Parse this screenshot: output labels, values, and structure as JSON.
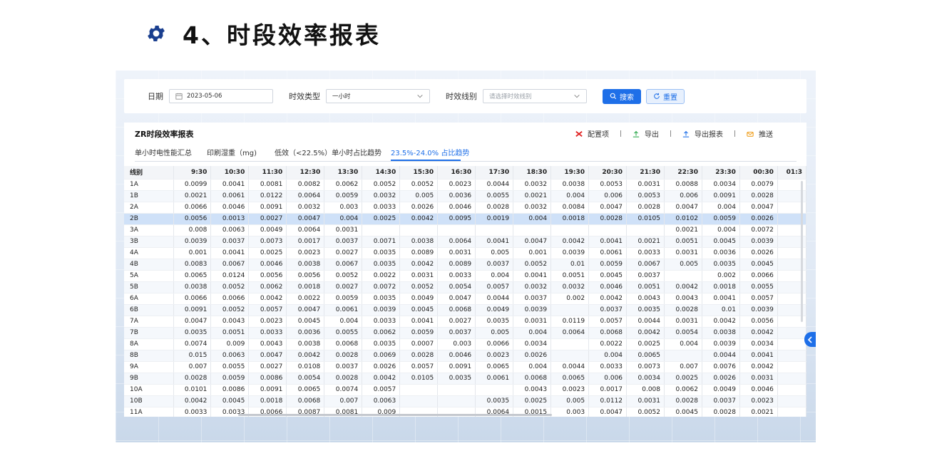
{
  "heading": {
    "icon": "gear-icon",
    "title": "4、时段效率报表"
  },
  "filter": {
    "date_label": "日期",
    "date_value": "2023-05-06",
    "type_label": "时效类型",
    "type_value": "一小时",
    "line_label": "时效线别",
    "line_placeholder": "请选择时效线别",
    "search_label": "搜索",
    "reset_label": "重置"
  },
  "report": {
    "title": "ZR时段效率报表",
    "actions": {
      "config": "配置项",
      "export": "导出",
      "export_report": "导出报表",
      "push": "推送"
    },
    "tabs": [
      "单小时电性能汇总",
      "印刷湿重（mg)",
      "低效（<22.5%）单小时占比趋势",
      "23.5%-24.0% 占比趋势"
    ],
    "active_tab": 3
  },
  "colors": {
    "accent": "#1e6fe8",
    "selected_row": "#cfe1f8",
    "config_icon": "#e02020",
    "export_icon": "#2aa84a",
    "push_icon": "#f0a020"
  },
  "table": {
    "columns": [
      "线别",
      "9:30",
      "10:30",
      "11:30",
      "12:30",
      "13:30",
      "14:30",
      "15:30",
      "16:30",
      "17:30",
      "18:30",
      "19:30",
      "20:30",
      "21:30",
      "22:30",
      "23:30",
      "00:30",
      "01:3"
    ],
    "selected_row": 3,
    "rows": [
      [
        "1A",
        "0.0099",
        "0.0041",
        "0.0081",
        "0.0082",
        "0.0062",
        "0.0052",
        "0.0052",
        "0.0023",
        "0.0044",
        "0.0032",
        "0.0038",
        "0.0053",
        "0.0031",
        "0.0088",
        "0.0034",
        "0.0079",
        ""
      ],
      [
        "1B",
        "0.0021",
        "0.0061",
        "0.0122",
        "0.0064",
        "0.0059",
        "0.0032",
        "0.005",
        "0.0036",
        "0.0055",
        "0.0021",
        "0.004",
        "0.006",
        "0.0053",
        "0.006",
        "0.0091",
        "0.0028",
        ""
      ],
      [
        "2A",
        "0.0066",
        "0.0046",
        "0.0091",
        "0.0032",
        "0.003",
        "0.0033",
        "0.0026",
        "0.0046",
        "0.0028",
        "0.0032",
        "0.0084",
        "0.0047",
        "0.0028",
        "0.0047",
        "0.004",
        "0.0047",
        ""
      ],
      [
        "2B",
        "0.0056",
        "0.0013",
        "0.0027",
        "0.0047",
        "0.004",
        "0.0025",
        "0.0042",
        "0.0095",
        "0.0019",
        "0.004",
        "0.0018",
        "0.0028",
        "0.0105",
        "0.0102",
        "0.0059",
        "0.0026",
        ""
      ],
      [
        "3A",
        "0.008",
        "0.0063",
        "0.0049",
        "0.0064",
        "0.0031",
        "",
        "",
        "",
        "",
        "",
        "",
        "",
        "",
        "0.0021",
        "0.004",
        "0.0072",
        ""
      ],
      [
        "3B",
        "0.0039",
        "0.0037",
        "0.0073",
        "0.0017",
        "0.0037",
        "0.0071",
        "0.0038",
        "0.0064",
        "0.0041",
        "0.0047",
        "0.0042",
        "0.0041",
        "0.0021",
        "0.0051",
        "0.0045",
        "0.0039",
        ""
      ],
      [
        "4A",
        "0.001",
        "0.0041",
        "0.0025",
        "0.0023",
        "0.0027",
        "0.0035",
        "0.0089",
        "0.0031",
        "0.005",
        "0.001",
        "0.0039",
        "0.0061",
        "0.0033",
        "0.0031",
        "0.0036",
        "0.0026",
        ""
      ],
      [
        "4B",
        "0.0083",
        "0.0067",
        "0.0046",
        "0.0038",
        "0.0067",
        "0.0035",
        "0.0042",
        "0.0089",
        "0.0037",
        "0.0052",
        "0.01",
        "0.0059",
        "0.0067",
        "0.005",
        "0.0035",
        "0.0045",
        ""
      ],
      [
        "5A",
        "0.0065",
        "0.0124",
        "0.0056",
        "0.0056",
        "0.0052",
        "0.0022",
        "0.0031",
        "0.0033",
        "0.004",
        "0.0041",
        "0.0051",
        "0.0045",
        "0.0037",
        "",
        "0.002",
        "0.0066",
        ""
      ],
      [
        "5B",
        "0.0038",
        "0.0052",
        "0.0062",
        "0.0018",
        "0.0027",
        "0.0072",
        "0.0052",
        "0.0054",
        "0.0057",
        "0.0032",
        "0.0032",
        "0.0046",
        "0.0051",
        "0.0042",
        "0.0018",
        "0.0055",
        ""
      ],
      [
        "6A",
        "0.0066",
        "0.0066",
        "0.0042",
        "0.0022",
        "0.0059",
        "0.0035",
        "0.0049",
        "0.0047",
        "0.0044",
        "0.0037",
        "0.002",
        "0.0042",
        "0.0043",
        "0.0043",
        "0.0041",
        "0.0057",
        ""
      ],
      [
        "6B",
        "0.0091",
        "0.0052",
        "0.0057",
        "0.0047",
        "0.0061",
        "0.0039",
        "0.0045",
        "0.0068",
        "0.0049",
        "0.0039",
        "",
        "0.0037",
        "0.0035",
        "0.0028",
        "0.01",
        "0.0039",
        ""
      ],
      [
        "7A",
        "0.0047",
        "0.0043",
        "0.0023",
        "0.0045",
        "0.004",
        "0.0033",
        "0.0041",
        "0.0027",
        "0.0035",
        "0.0031",
        "0.0119",
        "0.0057",
        "0.0044",
        "0.0031",
        "0.0042",
        "0.0056",
        ""
      ],
      [
        "7B",
        "0.0035",
        "0.0051",
        "0.0033",
        "0.0036",
        "0.0055",
        "0.0062",
        "0.0059",
        "0.0037",
        "0.005",
        "0.004",
        "0.0064",
        "0.0068",
        "0.0042",
        "0.0054",
        "0.0038",
        "0.0042",
        ""
      ],
      [
        "8A",
        "0.0074",
        "0.009",
        "0.0043",
        "0.0038",
        "0.0068",
        "0.0035",
        "0.0007",
        "0.003",
        "0.0066",
        "0.0034",
        "",
        "0.0022",
        "0.0025",
        "0.004",
        "0.0039",
        "0.0034",
        ""
      ],
      [
        "8B",
        "0.015",
        "0.0063",
        "0.0047",
        "0.0042",
        "0.0028",
        "0.0069",
        "0.0028",
        "0.0046",
        "0.0023",
        "0.0026",
        "",
        "0.004",
        "0.0065",
        "",
        "0.0044",
        "0.0041",
        ""
      ],
      [
        "9A",
        "0.007",
        "0.0055",
        "0.0027",
        "0.0108",
        "0.0037",
        "0.0026",
        "0.0057",
        "0.0091",
        "0.0065",
        "0.004",
        "0.0044",
        "0.0033",
        "0.0073",
        "0.007",
        "0.0076",
        "0.0042",
        ""
      ],
      [
        "9B",
        "0.0028",
        "0.0059",
        "0.0086",
        "0.0054",
        "0.0028",
        "0.0042",
        "0.0105",
        "0.0035",
        "0.0061",
        "0.0068",
        "0.0065",
        "0.006",
        "0.0034",
        "0.0025",
        "0.0026",
        "0.0031",
        ""
      ],
      [
        "10A",
        "0.0101",
        "0.0086",
        "0.0091",
        "0.0065",
        "0.0074",
        "0.0057",
        "",
        "",
        "",
        "0.0043",
        "0.0023",
        "0.0017",
        "0.008",
        "0.0062",
        "0.0049",
        "0.0046",
        ""
      ],
      [
        "10B",
        "0.0042",
        "0.0045",
        "0.0018",
        "0.0068",
        "0.007",
        "0.0063",
        "",
        "",
        "0.0035",
        "0.0025",
        "0.005",
        "0.0112",
        "0.0031",
        "0.0028",
        "0.0037",
        "0.0023",
        ""
      ],
      [
        "11A",
        "0.0033",
        "0.0033",
        "0.0066",
        "0.0087",
        "0.0081",
        "0.009",
        "",
        "",
        "0.0064",
        "0.0015",
        "0.003",
        "0.0047",
        "0.0052",
        "0.0045",
        "0.0028",
        "0.0021",
        ""
      ]
    ]
  }
}
